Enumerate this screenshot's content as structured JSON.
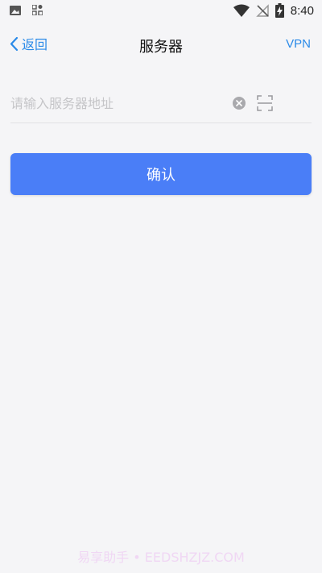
{
  "status_bar": {
    "time": "8:40",
    "icons": [
      "image-icon",
      "apps-icon",
      "wifi-icon",
      "signal-off-icon",
      "battery-charging-icon"
    ]
  },
  "nav": {
    "back_label": "返回",
    "title": "服务器",
    "vpn_label": "VPN"
  },
  "server_input": {
    "placeholder": "请输入服务器地址",
    "value": ""
  },
  "confirm_label": "确认",
  "watermark": "易享助手 • EEDSHZJZ.COM",
  "colors": {
    "accent": "#2a8ae8",
    "button": "#4a7ef7",
    "background": "#f5f5f7"
  }
}
